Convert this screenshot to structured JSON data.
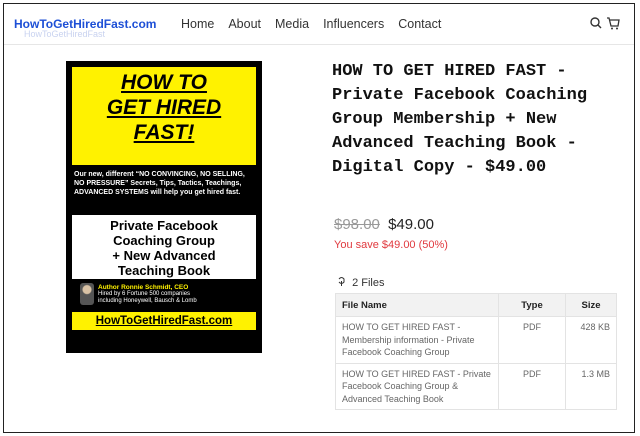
{
  "header": {
    "logo": "HowToGetHiredFast.com",
    "logo_shadow": "HowToGetHiredFast",
    "nav": [
      "Home",
      "About",
      "Media",
      "Influencers",
      "Contact"
    ],
    "icons": [
      "search-icon",
      "cart-icon"
    ]
  },
  "cover": {
    "headline": [
      "HOW TO",
      "GET HIRED",
      "FAST!"
    ],
    "blurb": "Our new, different “NO CONVINCING, NO SELLING, NO PRESSURE” Secrets, Tips, Tactics, Teachings, ADVANCED SYSTEMS will help you get hired fast.",
    "offer": [
      "Private Facebook",
      "Coaching Group",
      "+ New Advanced",
      "Teaching Book"
    ],
    "author_name": "Author Ronnie Schmidt, CEO",
    "author_line1": "Hired by 6 Fortune 500 companies",
    "author_line2": "including Honeywell, Bausch & Lomb",
    "url": "HowToGetHiredFast.com",
    "colors": {
      "yellow": "#fff200",
      "black": "#000000"
    }
  },
  "product": {
    "title": "HOW TO GET HIRED FAST - Private Facebook Coaching Group Membership + New Advanced Teaching Book - Digital Copy - $49.00",
    "old_price": "$98.00",
    "price": "$49.00",
    "savings": "You save $49.00 (50%)",
    "files_label": "2 Files"
  },
  "files_table": {
    "headers": [
      "File Name",
      "Type",
      "Size"
    ],
    "rows": [
      {
        "name": "HOW TO GET HIRED FAST - Membership information - Private Facebook Coaching Group",
        "type": "PDF",
        "size": "428 KB"
      },
      {
        "name": "HOW TO GET HIRED FAST - Private Facebook Coaching Group & Advanced Teaching Book",
        "type": "PDF",
        "size": "1.3 MB"
      }
    ]
  },
  "colors": {
    "accent": "#1d4fd6",
    "savings": "#e0393e"
  }
}
